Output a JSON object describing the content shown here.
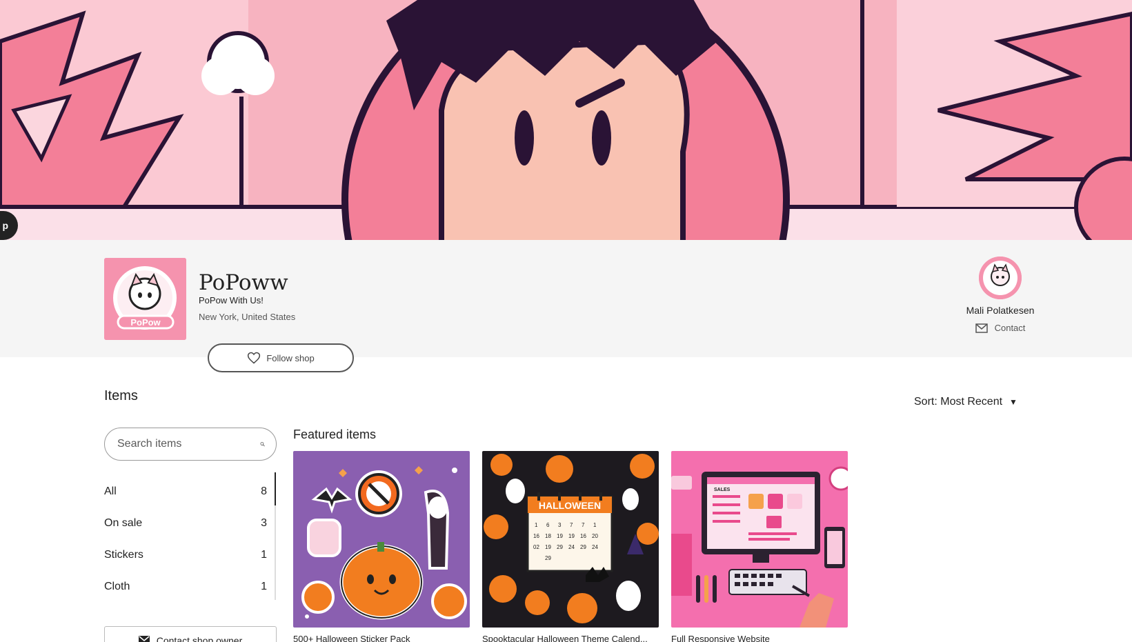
{
  "banner": {
    "edit_pill_label": "p"
  },
  "shop": {
    "name": "PoPoww",
    "tagline": "PoPow With Us!",
    "location": "New York, United States",
    "follow_label": "Follow shop",
    "logo_text": "PoPow"
  },
  "owner": {
    "name": "Mali Polatkesen",
    "contact_label": "Contact"
  },
  "items": {
    "heading": "Items",
    "sort_label": "Sort: Most Recent",
    "search_placeholder": "Search items",
    "categories": [
      {
        "label": "All",
        "count": "8"
      },
      {
        "label": "On sale",
        "count": "3"
      },
      {
        "label": "Stickers",
        "count": "1"
      },
      {
        "label": "Cloth",
        "count": "1"
      }
    ],
    "contact_owner_label": "Contact shop owner"
  },
  "featured": {
    "heading": "Featured items",
    "cards": [
      {
        "title": "500+ Halloween Sticker Pack"
      },
      {
        "title": "Spooktacular Halloween Theme Calend...",
        "image_text": "HALLOWEEN"
      },
      {
        "title": "Full Responsive Website",
        "image_text": "SALES"
      }
    ]
  },
  "colors": {
    "brand_pink": "#f593ae",
    "banner_pink": "#f6a9b6",
    "dark": "#222222"
  },
  "icons": [
    "heart-icon",
    "mail-icon",
    "search-icon",
    "caret-down-icon",
    "envelope-icon"
  ]
}
